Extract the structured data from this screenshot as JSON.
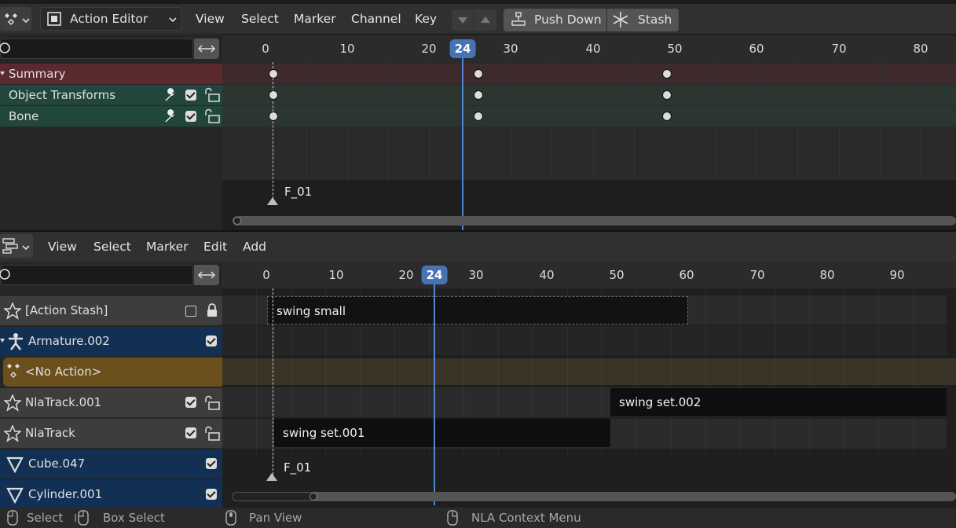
{
  "action_editor": {
    "mode_label": "Action Editor",
    "menus": [
      "View",
      "Select",
      "Marker",
      "Channel",
      "Key"
    ],
    "push_down_label": "Push Down",
    "stash_label": "Stash",
    "ruler_ticks": [
      "0",
      "10",
      "20",
      "30",
      "40",
      "50",
      "60",
      "70",
      "80"
    ],
    "current_frame": "24",
    "channels": [
      {
        "label": "Summary"
      },
      {
        "label": "Object Transforms"
      },
      {
        "label": "Bone"
      }
    ],
    "marker_label": "F_01"
  },
  "nla_editor": {
    "menus": [
      "View",
      "Select",
      "Marker",
      "Edit",
      "Add"
    ],
    "ruler_ticks": [
      "0",
      "10",
      "20",
      "30",
      "40",
      "50",
      "60",
      "70",
      "80",
      "90"
    ],
    "current_frame": "24",
    "tracks": [
      {
        "label": "[Action Stash]"
      },
      {
        "label": "Armature.002"
      },
      {
        "label": "<No Action>"
      },
      {
        "label": "NlaTrack.001"
      },
      {
        "label": "NlaTrack"
      },
      {
        "label": "Cube.047"
      },
      {
        "label": "Cylinder.001"
      }
    ],
    "strips": {
      "swing_small": "swing small",
      "swing_set_002": "swing set.002",
      "swing_set_001": "swing set.001"
    },
    "marker_label": "F_01"
  },
  "status_bar": {
    "select": "Select",
    "box_select": "Box Select",
    "pan_view": "Pan View",
    "context_menu": "NLA Context Menu"
  },
  "colors": {
    "summary_row": "#5a2a2f",
    "channel_row": "#22463c",
    "object_row": "#123054",
    "no_action_row": "#6b4f1c",
    "current_frame": "#4772b3"
  }
}
